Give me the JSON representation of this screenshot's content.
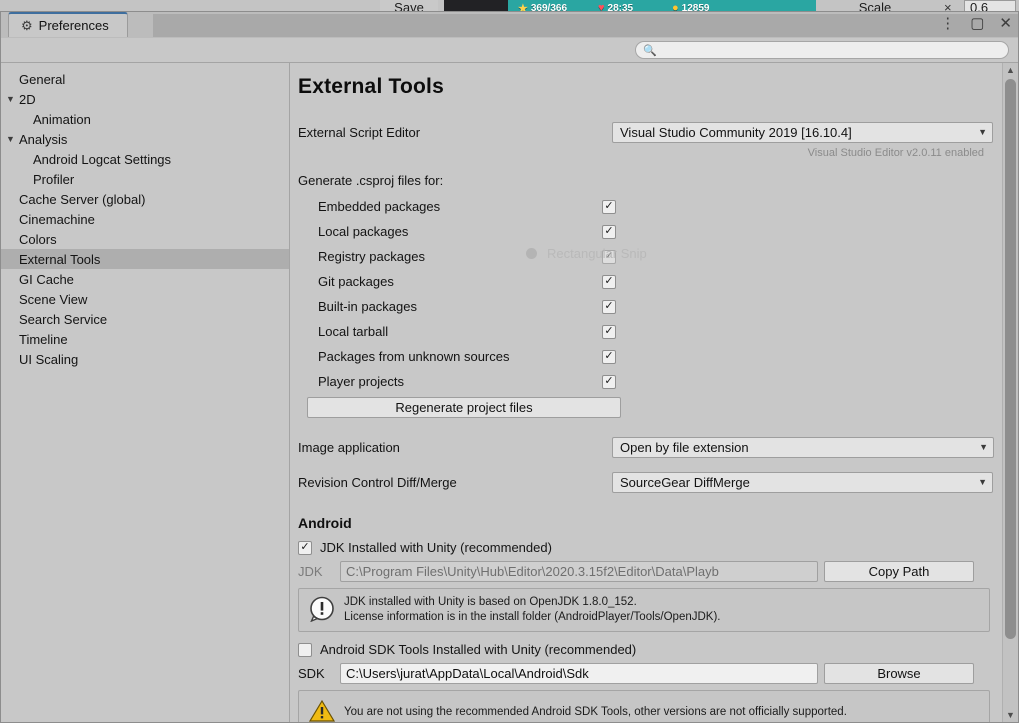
{
  "background": {
    "save_label": "Save",
    "scale_label": "Scale",
    "scale_x": "×",
    "scale_value": "0.6",
    "hud": [
      {
        "icon": "star-icon",
        "glyph": "★",
        "value": "369/366",
        "color": "#ffd34d"
      },
      {
        "icon": "heart-icon",
        "glyph": "♥",
        "value": "28:35",
        "color": "#ff4f5a"
      },
      {
        "icon": "coin-icon",
        "glyph": "●",
        "value": "12859",
        "color": "#ffc42e"
      }
    ]
  },
  "window": {
    "tab_title": "Preferences",
    "tab_icon": "gear-icon",
    "controls": {
      "menu": "⋮",
      "maximize": "▢",
      "close": "✕"
    }
  },
  "search": {
    "placeholder": "",
    "value": "",
    "icon": "search-icon"
  },
  "sidebar": {
    "items": [
      {
        "label": "General",
        "indent": 0,
        "arrow": "",
        "selected": false
      },
      {
        "label": "2D",
        "indent": 0,
        "arrow": "▼",
        "selected": false
      },
      {
        "label": "Animation",
        "indent": 1,
        "arrow": "",
        "selected": false
      },
      {
        "label": "Analysis",
        "indent": 0,
        "arrow": "▼",
        "selected": false
      },
      {
        "label": "Android Logcat Settings",
        "indent": 1,
        "arrow": "",
        "selected": false
      },
      {
        "label": "Profiler",
        "indent": 1,
        "arrow": "",
        "selected": false
      },
      {
        "label": "Cache Server (global)",
        "indent": 0,
        "arrow": "",
        "selected": false
      },
      {
        "label": "Cinemachine",
        "indent": 0,
        "arrow": "",
        "selected": false
      },
      {
        "label": "Colors",
        "indent": 0,
        "arrow": "",
        "selected": false
      },
      {
        "label": "External Tools",
        "indent": 0,
        "arrow": "",
        "selected": true
      },
      {
        "label": "GI Cache",
        "indent": 0,
        "arrow": "",
        "selected": false
      },
      {
        "label": "Scene View",
        "indent": 0,
        "arrow": "",
        "selected": false
      },
      {
        "label": "Search Service",
        "indent": 0,
        "arrow": "",
        "selected": false
      },
      {
        "label": "Timeline",
        "indent": 0,
        "arrow": "",
        "selected": false
      },
      {
        "label": "UI Scaling",
        "indent": 0,
        "arrow": "",
        "selected": false
      }
    ]
  },
  "main": {
    "title": "External Tools",
    "script_editor": {
      "label": "External Script Editor",
      "value": "Visual Studio Community 2019 [16.10.4]",
      "note": "Visual Studio Editor v2.0.11 enabled"
    },
    "csproj": {
      "lead": "Generate .csproj files for:",
      "items": [
        {
          "label": "Embedded packages",
          "checked": true
        },
        {
          "label": "Local packages",
          "checked": true
        },
        {
          "label": "Registry packages",
          "checked": true
        },
        {
          "label": "Git packages",
          "checked": true
        },
        {
          "label": "Built-in packages",
          "checked": true
        },
        {
          "label": "Local tarball",
          "checked": true
        },
        {
          "label": "Packages from unknown sources",
          "checked": true
        },
        {
          "label": "Player projects",
          "checked": true
        }
      ],
      "regenerate_label": "Regenerate project files"
    },
    "image_application": {
      "label": "Image application",
      "value": "Open by file extension"
    },
    "revision_control": {
      "label": "Revision Control Diff/Merge",
      "value": "SourceGear DiffMerge"
    },
    "android": {
      "heading": "Android",
      "jdk_checkbox": {
        "label": "JDK Installed with Unity (recommended)",
        "checked": true
      },
      "jdk_path": {
        "label": "JDK",
        "value": "C:\\Program Files\\Unity\\Hub\\Editor\\2020.3.15f2\\Editor\\Data\\Playb",
        "button": "Copy Path",
        "disabled": true
      },
      "jdk_info": {
        "icon": "info-icon",
        "line1": "JDK installed with Unity is based on OpenJDK 1.8.0_152.",
        "line2": "License information is in the install folder (AndroidPlayer/Tools/OpenJDK)."
      },
      "sdk_checkbox": {
        "label": "Android SDK Tools Installed with Unity (recommended)",
        "checked": false
      },
      "sdk_path": {
        "label": "SDK",
        "value": "C:\\Users\\jurat\\AppData\\Local\\Android\\Sdk",
        "button": "Browse",
        "disabled": false
      },
      "sdk_warning": {
        "icon": "warning-icon",
        "text": "You are not using the recommended Android SDK Tools, other versions are not officially supported."
      }
    },
    "caret": "▼"
  },
  "overlay": {
    "snip_label": "Rectangular Snip"
  },
  "colors": {
    "window_bg": "#c8c8c8",
    "tab_accent": "#3e6e9e",
    "selection": "#aeaeae",
    "warning": "#e8b400",
    "note_text": "#8b8b8b"
  }
}
